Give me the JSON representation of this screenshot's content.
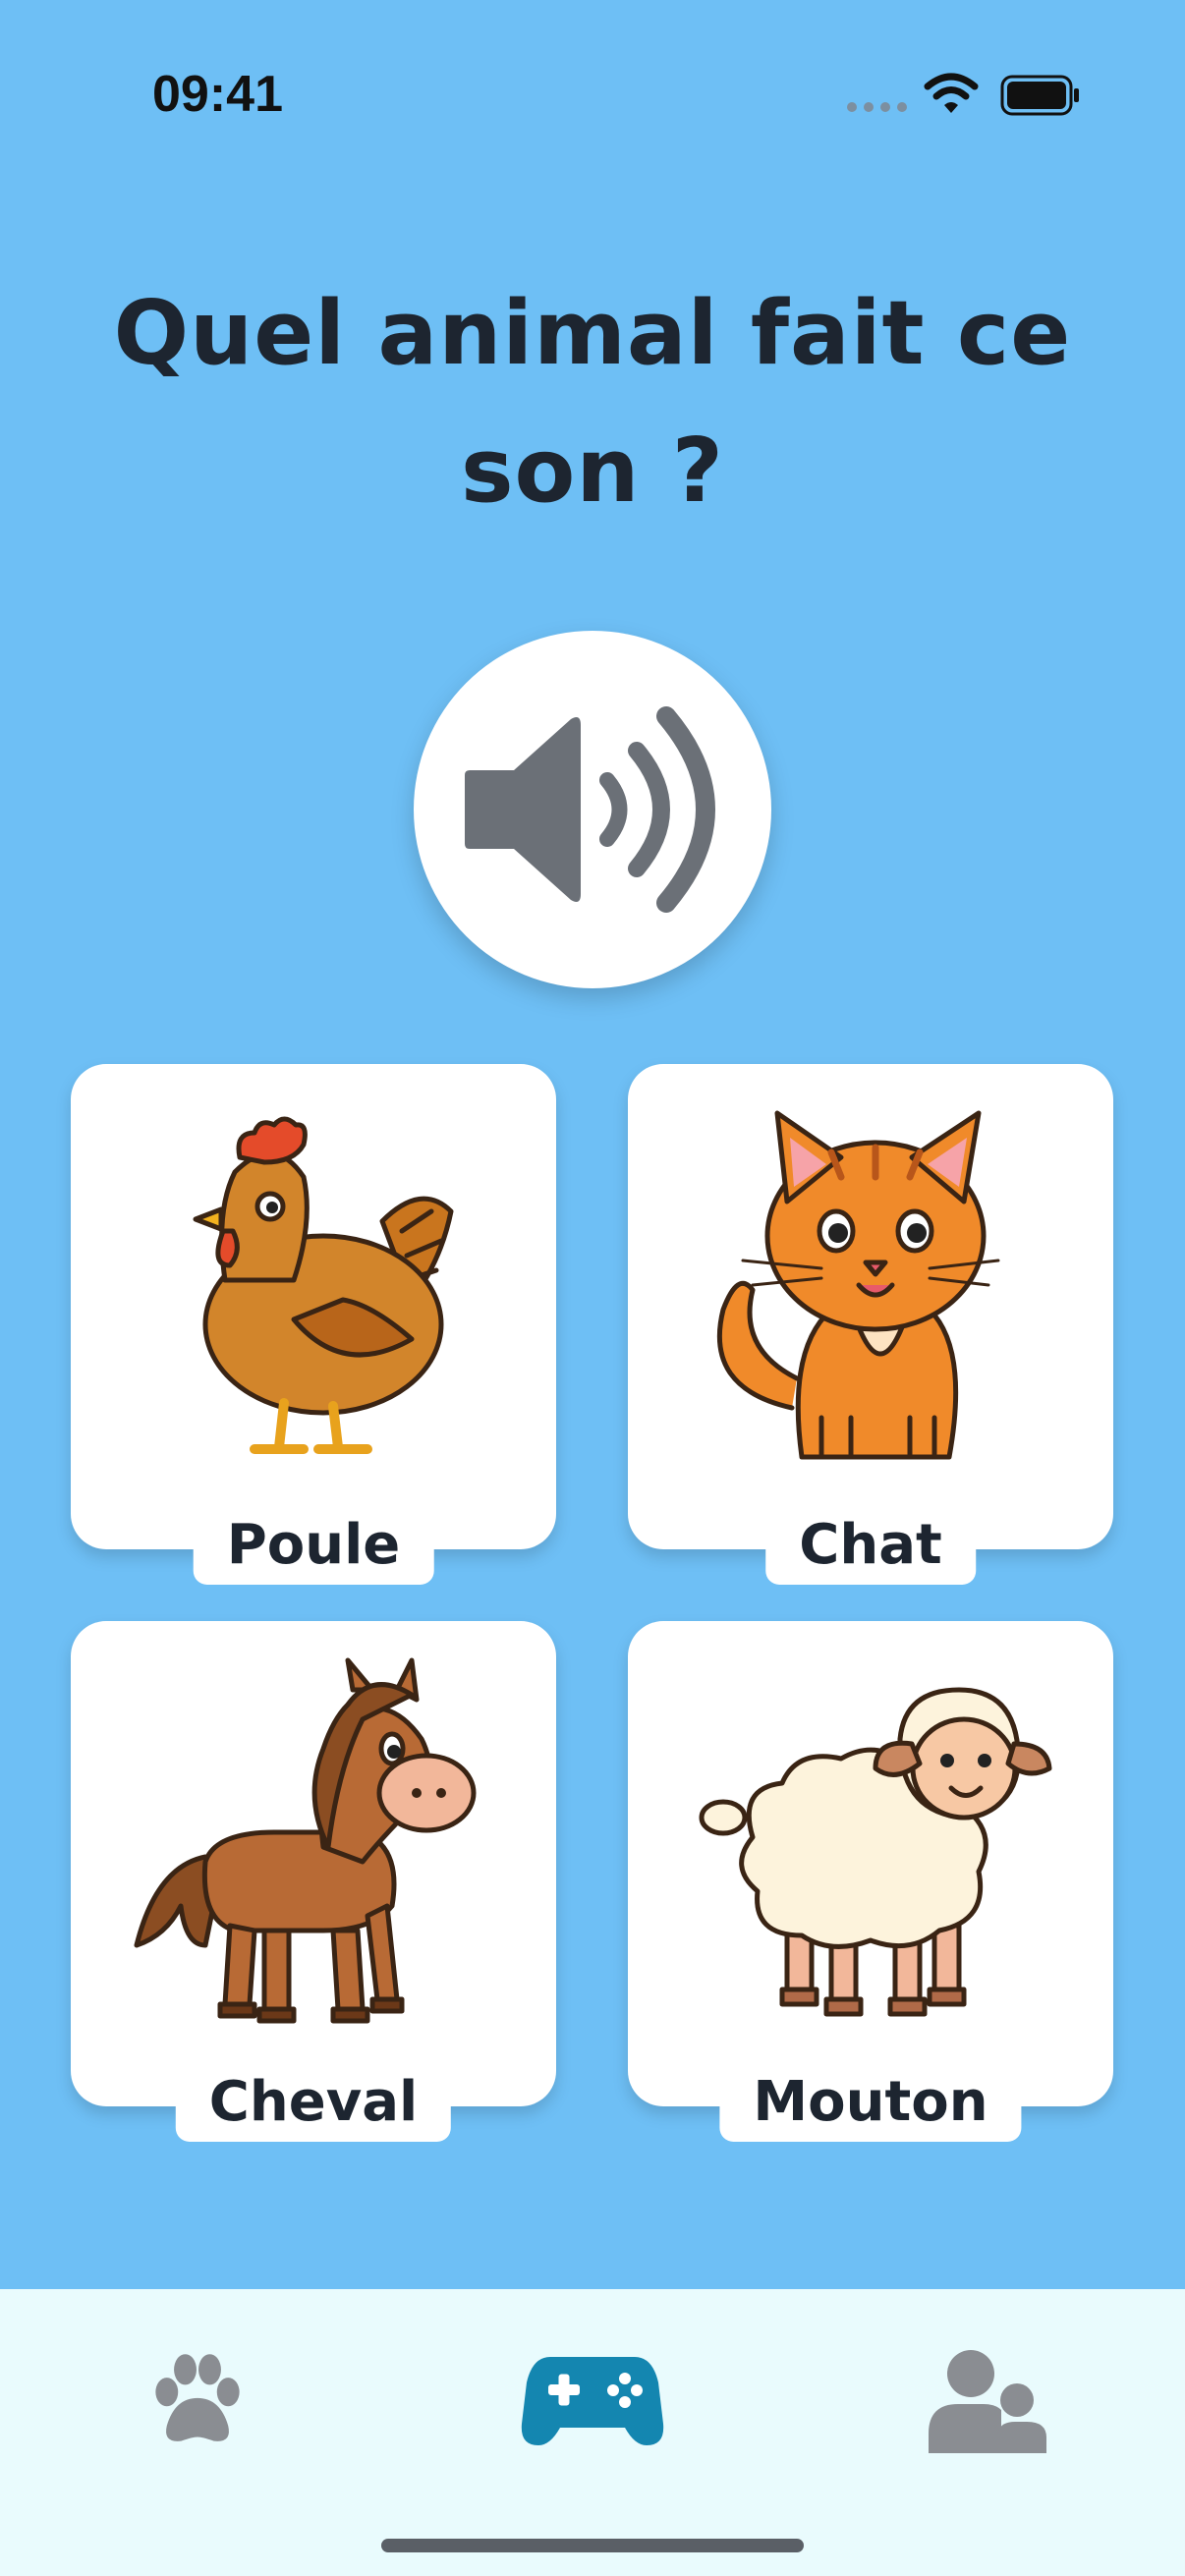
{
  "status_bar": {
    "time": "09:41"
  },
  "quiz": {
    "question": "Quel animal fait ce son ?",
    "options": [
      {
        "label": "Poule",
        "icon": "hen-illustration"
      },
      {
        "label": "Chat",
        "icon": "cat-illustration"
      },
      {
        "label": "Cheval",
        "icon": "horse-illustration"
      },
      {
        "label": "Mouton",
        "icon": "sheep-illustration"
      }
    ]
  },
  "sound_button": {
    "icon": "speaker-icon"
  },
  "tab_bar": {
    "tabs": [
      {
        "icon": "paw-icon",
        "active": false
      },
      {
        "icon": "gamepad-icon",
        "active": true
      },
      {
        "icon": "users-icon",
        "active": false
      }
    ]
  },
  "colors": {
    "background": "#6ebff5",
    "tab_bar": "#e9fbfd",
    "active_tab": "#1486b0",
    "inactive_tab": "#8a8d92",
    "speaker": "#6b7077"
  }
}
